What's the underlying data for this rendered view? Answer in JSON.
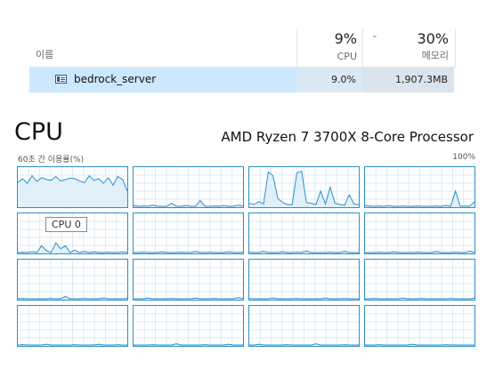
{
  "table": {
    "name_header": "이름",
    "cpu_percent": "9%",
    "cpu_label": "CPU",
    "mem_percent": "30%",
    "mem_label": "메모리",
    "sort_icon": "chevron-down-icon",
    "row": {
      "icon": "app-window-icon",
      "name": "bedrock_server",
      "cpu": "9.0%",
      "memory": "1,907.3MB"
    }
  },
  "cpu": {
    "title": "CPU",
    "model": "AMD Ryzen 7 3700X 8-Core Processor",
    "axis_left": "60초 간 이용률(%)",
    "axis_right": "100%",
    "tooltip": "CPU 0",
    "line_color": "#2c8fc8",
    "fill_color": "#e1eff9"
  },
  "cores": [
    [
      62,
      72,
      60,
      80,
      65,
      75,
      70,
      68,
      78,
      66,
      70,
      74,
      72,
      66,
      62,
      80,
      68,
      72,
      60,
      75,
      55,
      78,
      70,
      40
    ],
    [
      2,
      0,
      1,
      0,
      3,
      0,
      0,
      0,
      8,
      0,
      0,
      2,
      0,
      0,
      15,
      0,
      0,
      1,
      0,
      2,
      0,
      0,
      3,
      1
    ],
    [
      8,
      5,
      12,
      6,
      90,
      80,
      20,
      10,
      5,
      4,
      88,
      92,
      10,
      8,
      5,
      40,
      6,
      50,
      8,
      5,
      3,
      30,
      6,
      4
    ],
    [
      2,
      1,
      0,
      1,
      0,
      2,
      0,
      0,
      1,
      0,
      0,
      1,
      0,
      0,
      0,
      1,
      0,
      2,
      0,
      40,
      0,
      1,
      0,
      12
    ],
    [
      0,
      1,
      0,
      2,
      0,
      18,
      5,
      0,
      25,
      10,
      18,
      0,
      6,
      0,
      3,
      0,
      2,
      0,
      0,
      1,
      0,
      0,
      2,
      0
    ],
    [
      0,
      0,
      1,
      0,
      0,
      0,
      2,
      0,
      0,
      0,
      1,
      0,
      0,
      3,
      0,
      0,
      1,
      0,
      0,
      0,
      2,
      0,
      0,
      1
    ],
    [
      1,
      0,
      0,
      3,
      0,
      0,
      0,
      2,
      0,
      0,
      1,
      0,
      4,
      0,
      0,
      0,
      0,
      1,
      0,
      0,
      3,
      0,
      0,
      0
    ],
    [
      0,
      0,
      0,
      1,
      0,
      0,
      2,
      0,
      0,
      0,
      0,
      1,
      0,
      0,
      0,
      3,
      0,
      0,
      0,
      1,
      0,
      0,
      4,
      0
    ],
    [
      0,
      1,
      0,
      0,
      0,
      0,
      0,
      1,
      0,
      0,
      6,
      0,
      0,
      0,
      1,
      0,
      0,
      0,
      2,
      0,
      0,
      0,
      0,
      1
    ],
    [
      0,
      0,
      0,
      2,
      0,
      0,
      0,
      0,
      1,
      0,
      0,
      0,
      0,
      2,
      0,
      0,
      0,
      1,
      0,
      0,
      0,
      0,
      3,
      0
    ],
    [
      1,
      0,
      0,
      0,
      0,
      2,
      0,
      0,
      0,
      0,
      1,
      0,
      0,
      0,
      0,
      0,
      2,
      0,
      0,
      0,
      1,
      0,
      0,
      0
    ],
    [
      0,
      0,
      1,
      0,
      0,
      0,
      0,
      0,
      2,
      0,
      0,
      0,
      1,
      0,
      0,
      0,
      0,
      0,
      1,
      0,
      0,
      0,
      0,
      2
    ],
    [
      0,
      1,
      0,
      0,
      0,
      0,
      2,
      0,
      0,
      0,
      0,
      0,
      1,
      0,
      0,
      0,
      0,
      2,
      0,
      0,
      0,
      1,
      0,
      0
    ],
    [
      0,
      0,
      0,
      0,
      1,
      0,
      0,
      0,
      0,
      3,
      0,
      0,
      0,
      0,
      0,
      1,
      0,
      0,
      0,
      0,
      2,
      0,
      0,
      0
    ],
    [
      0,
      0,
      2,
      0,
      0,
      0,
      0,
      0,
      1,
      0,
      0,
      0,
      0,
      0,
      3,
      0,
      0,
      0,
      0,
      0,
      1,
      0,
      0,
      0
    ],
    [
      0,
      0,
      0,
      1,
      0,
      0,
      0,
      0,
      0,
      0,
      2,
      0,
      0,
      0,
      0,
      0,
      0,
      1,
      0,
      0,
      0,
      0,
      0,
      0
    ]
  ]
}
